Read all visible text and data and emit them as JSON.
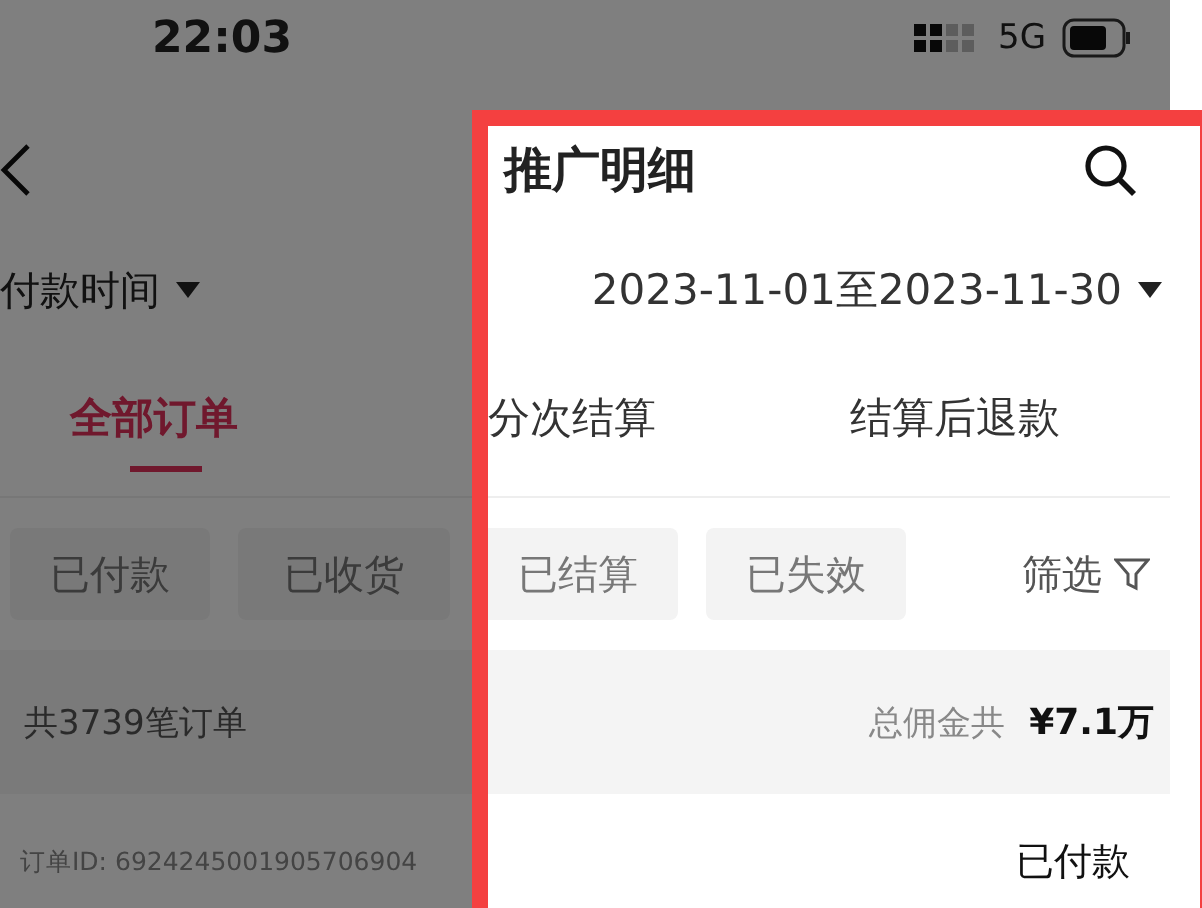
{
  "status_bar": {
    "time": "22:03",
    "network": "5G"
  },
  "nav": {
    "title": "推广明细"
  },
  "date_filter": {
    "label": "付款时间",
    "range": "2023-11-01至2023-11-30"
  },
  "tabs": [
    {
      "label": "全部订单",
      "selected": true
    },
    {
      "label": "分次结算",
      "selected": false
    },
    {
      "label": "结算后退款",
      "selected": false
    }
  ],
  "status_chips": [
    {
      "label": "已付款",
      "selected": false
    },
    {
      "label": "已收货",
      "selected": false
    },
    {
      "label": "已结算",
      "selected": false
    },
    {
      "label": "已失效",
      "selected": false
    }
  ],
  "filter": {
    "label": "筛选"
  },
  "summary": {
    "count": "共3739笔订单",
    "commission_label": "总佣金共",
    "commission_value": "¥7.1万"
  },
  "orders": [
    {
      "id_text": "订单ID: 6924245001905706904",
      "status": "已付款"
    }
  ]
}
